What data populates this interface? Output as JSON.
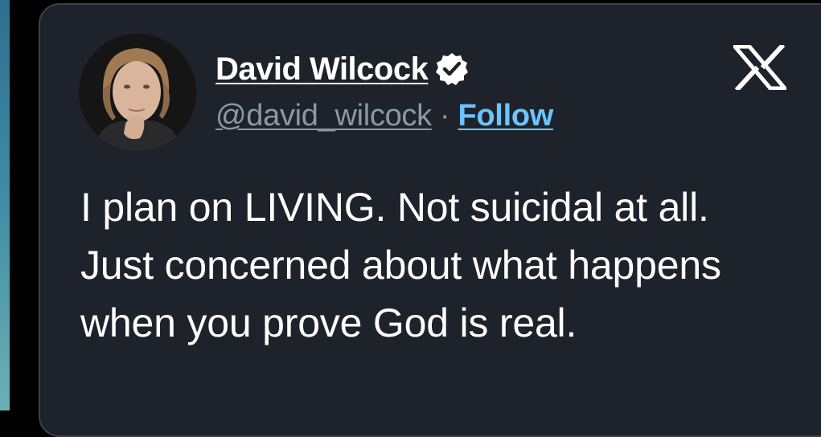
{
  "author": {
    "display_name": "David Wilcock",
    "handle": "@david_wilcock",
    "verified": true,
    "avatar_icon": "profile-photo"
  },
  "header": {
    "separator": "·",
    "follow_label": "Follow",
    "brand_icon": "x-logo-icon"
  },
  "tweet": {
    "text": "I plan on LIVING. Not suicidal at all. Just concerned about what happens when you prove God is real."
  },
  "colors": {
    "card_background": "#1e232b",
    "card_border": "#3a414b",
    "text_primary": "#ffffff",
    "text_secondary": "#8b98a5",
    "link": "#6bc3ff"
  }
}
